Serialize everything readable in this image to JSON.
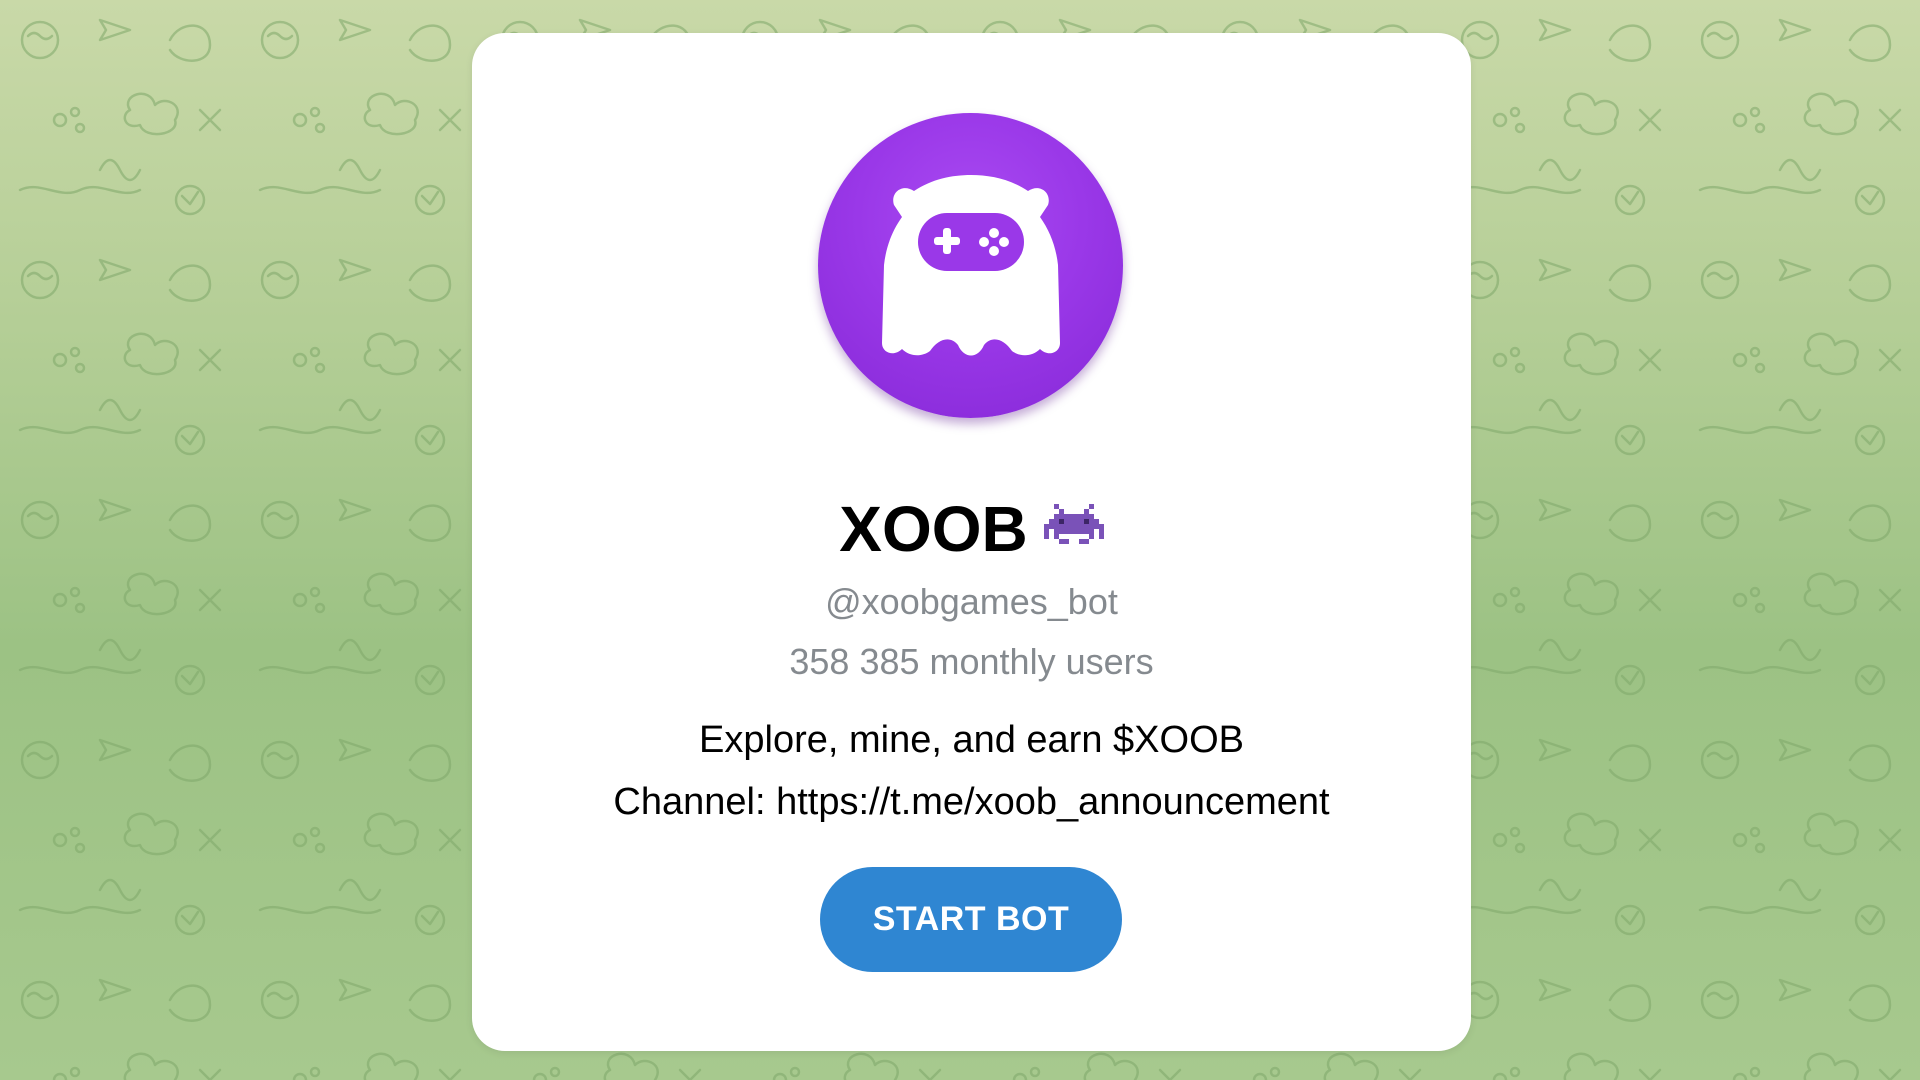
{
  "bot": {
    "title": "XOOB",
    "title_emoji_icon": "space-invader-icon",
    "username": "@xoobgames_bot",
    "monthly_users": "358 385 monthly users",
    "description_line1": "Explore, mine, and earn $XOOB",
    "description_line2": "Channel: https://t.me/xoob_announcement",
    "avatar_icon": "gamepad-monster-icon"
  },
  "actions": {
    "start_label": "START BOT"
  },
  "colors": {
    "accent": "#2f86d2",
    "avatar_purple": "#9a38e8",
    "background_green": "#a8c98e",
    "secondary_text": "#858a8f"
  }
}
